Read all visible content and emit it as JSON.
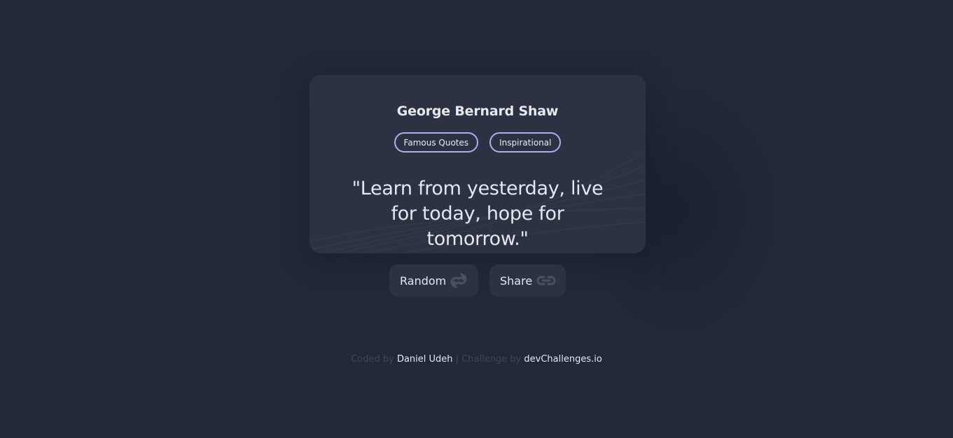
{
  "quote_card": {
    "author": "George Bernard Shaw",
    "tags": [
      "Famous Quotes",
      "Inspirational"
    ],
    "quote": "\"Learn from yesterday, live for today, hope for tomorrow.\""
  },
  "actions": {
    "random_label": "Random",
    "random_icon": "shuffle-icon",
    "share_label": "Share",
    "share_icon": "link-icon"
  },
  "footer": {
    "coded_by": "Coded by",
    "author_name": "Daniel Udeh",
    "separator": "|",
    "challenge_by": "Challenge by",
    "challenge_site": "devChallenges.io"
  },
  "colors": {
    "background": "#212839",
    "card": "#2d3242",
    "tag_border": "#a9b0ef",
    "text": "#e6e8f0",
    "muted_text": "#3f4659"
  }
}
